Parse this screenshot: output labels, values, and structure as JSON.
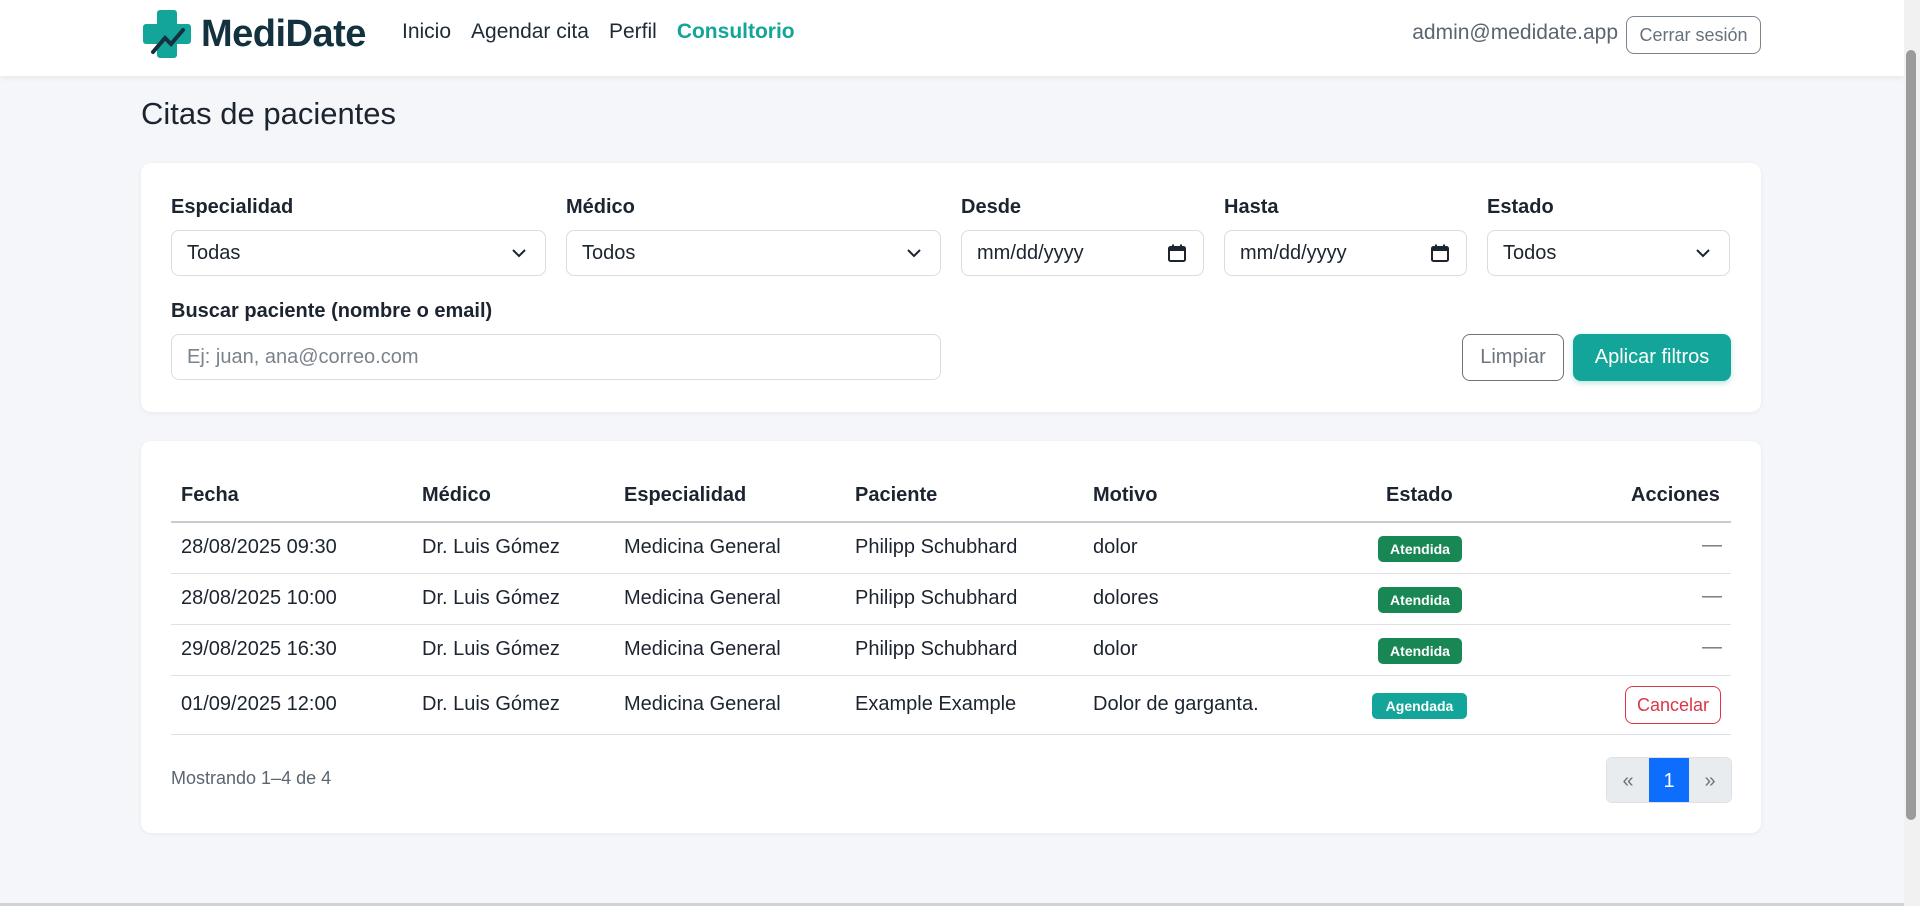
{
  "nav": {
    "brand": "MediDate",
    "links": [
      "Inicio",
      "Agendar cita",
      "Perfil",
      "Consultorio"
    ],
    "active_link": "Consultorio",
    "user_email": "admin@medidate.app",
    "logout_label": "Cerrar sesión"
  },
  "page_title": "Citas de pacientes",
  "filters": {
    "specialty": {
      "label": "Especialidad",
      "value": "Todas"
    },
    "doctor": {
      "label": "Médico",
      "value": "Todos"
    },
    "from": {
      "label": "Desde",
      "placeholder": "mm/dd/yyyy"
    },
    "to": {
      "label": "Hasta",
      "placeholder": "mm/dd/yyyy"
    },
    "status": {
      "label": "Estado",
      "value": "Todos"
    },
    "search": {
      "label": "Buscar paciente (nombre o email)",
      "placeholder": "Ej: juan, ana@correo.com"
    },
    "clear_label": "Limpiar",
    "apply_label": "Aplicar filtros"
  },
  "table": {
    "headers": [
      "Fecha",
      "Médico",
      "Especialidad",
      "Paciente",
      "Motivo",
      "Estado",
      "Acciones"
    ],
    "rows": [
      {
        "fecha": "28/08/2025 09:30",
        "medico": "Dr. Luis Gómez",
        "especialidad": "Medicina General",
        "paciente": "Philipp Schubhard",
        "motivo": "dolor",
        "estado": "Atendida",
        "accion": "—"
      },
      {
        "fecha": "28/08/2025 10:00",
        "medico": "Dr. Luis Gómez",
        "especialidad": "Medicina General",
        "paciente": "Philipp Schubhard",
        "motivo": "dolores",
        "estado": "Atendida",
        "accion": "—"
      },
      {
        "fecha": "29/08/2025 16:30",
        "medico": "Dr. Luis Gómez",
        "especialidad": "Medicina General",
        "paciente": "Philipp Schubhard",
        "motivo": "dolor",
        "estado": "Atendida",
        "accion": "—"
      },
      {
        "fecha": "01/09/2025 12:00",
        "medico": "Dr. Luis Gómez",
        "especialidad": "Medicina General",
        "paciente": "Example Example",
        "motivo": "Dolor de garganta.",
        "estado": "Agendada",
        "accion": "Cancelar"
      }
    ]
  },
  "footer": {
    "showing": "Mostrando 1–4 de 4",
    "prev": "«",
    "page": "1",
    "next": "»"
  },
  "colors": {
    "brand": "#14a59a",
    "brand_dark": "#14313f",
    "status_done": "#198754",
    "status_scheduled": "#14a59a",
    "danger": "#dc3545",
    "pager_active": "#0d6efd"
  },
  "icons": {
    "brand_logo": "medical-cross-icon",
    "select_chevron": "chevron-down-icon",
    "date_picker": "calendar-icon"
  }
}
